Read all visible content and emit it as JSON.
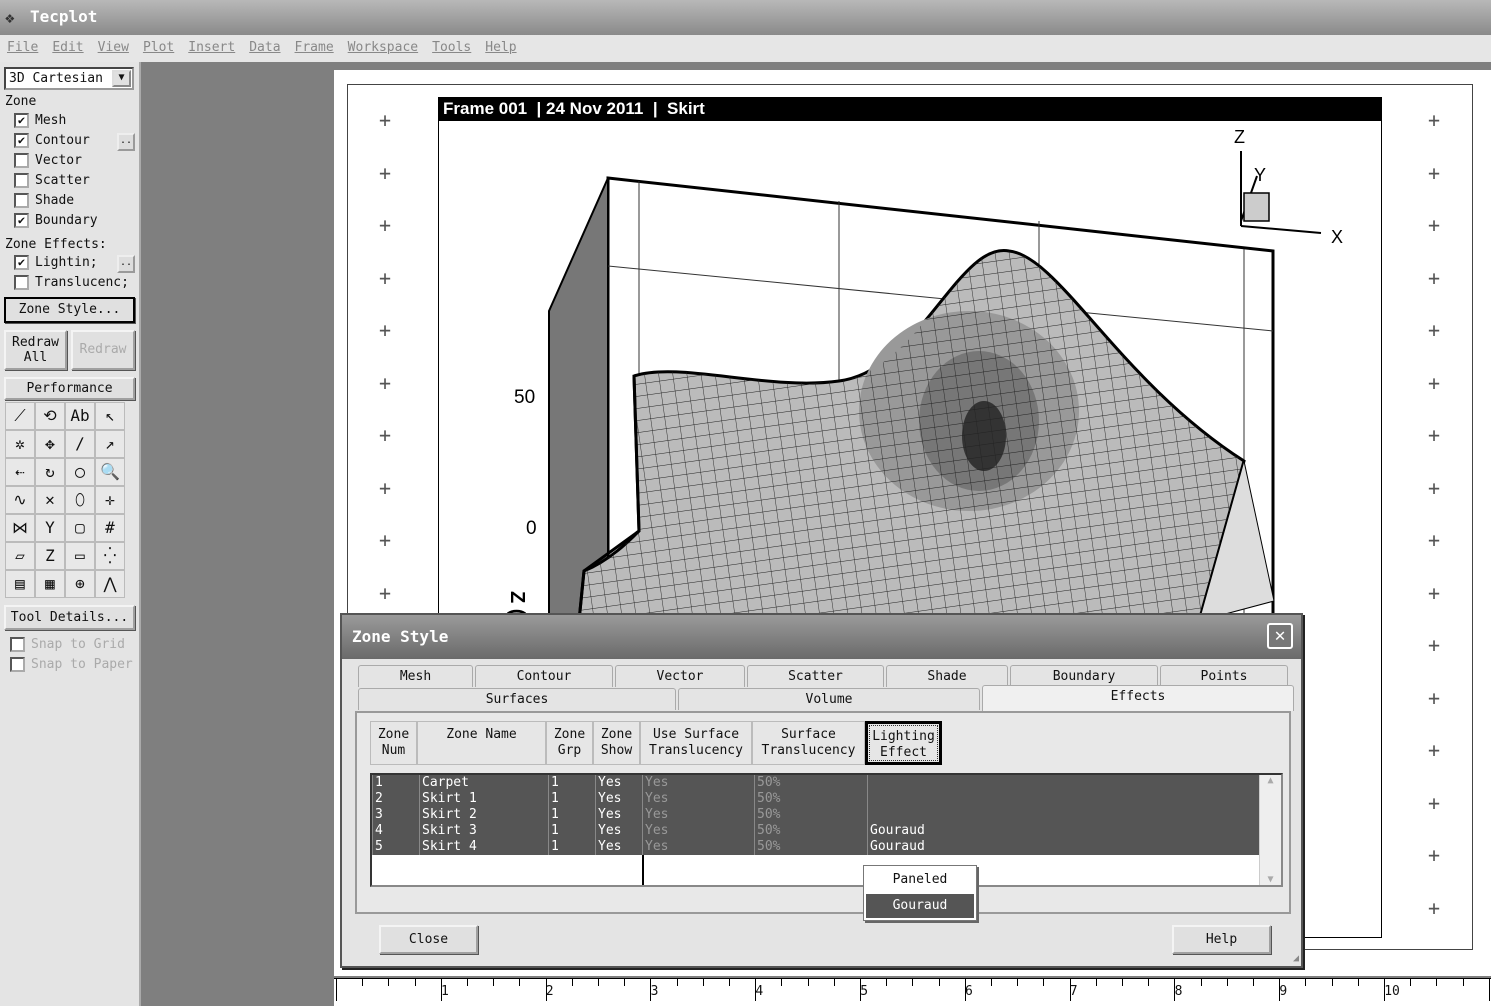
{
  "app": {
    "title": "Tecplot"
  },
  "menu": [
    "File",
    "Edit",
    "View",
    "Plot",
    "Insert",
    "Data",
    "Frame",
    "Workspace",
    "Tools",
    "Help"
  ],
  "sidebar": {
    "plot_type": "3D Cartesian",
    "zone_label": "Zone",
    "zone_layers": [
      {
        "label": "Mesh",
        "checked": true
      },
      {
        "label": "Contour",
        "checked": true
      },
      {
        "label": "Vector",
        "checked": false
      },
      {
        "label": "Scatter",
        "checked": false
      },
      {
        "label": "Shade",
        "checked": false
      },
      {
        "label": "Boundary",
        "checked": true
      }
    ],
    "effects_label": "Zone Effects:",
    "effects": [
      {
        "label": "Lightin;",
        "checked": true
      },
      {
        "label": "Translucenc;",
        "checked": false
      }
    ],
    "zone_style_button": "Zone Style...",
    "redraw_all": "Redraw All",
    "redraw": "Redraw",
    "performance": "Performance",
    "tool_details": "Tool Details...",
    "snap_grid": "Snap to Grid",
    "snap_paper": "Snap to Paper",
    "tool_icons": [
      "⟋",
      "⟲",
      "Ab",
      "↖",
      "✲",
      "✥",
      "∕",
      "↗",
      "⇠",
      "↻",
      "◯",
      "🔍",
      "∿",
      "✕",
      "⬯",
      "✛",
      "⋈",
      "Y",
      "▢",
      "#",
      "▱",
      "Z",
      "▭",
      "⁛",
      "▤",
      "▦",
      "⊕",
      "⋀"
    ]
  },
  "plot": {
    "header": "Frame 001  | 24 Nov 2011  |  Skirt",
    "axis_z_title": "Z (M)",
    "z_ticks": [
      "50",
      "0"
    ],
    "triad": {
      "x": "X",
      "y": "Y",
      "z": "Z"
    }
  },
  "ruler": {
    "labels": [
      "1",
      "2",
      "3",
      "4",
      "5",
      "6",
      "7",
      "8",
      "9",
      "10"
    ]
  },
  "dialog": {
    "title": "Zone Style",
    "tabs_row1": [
      "Mesh",
      "Contour",
      "Vector",
      "Scatter",
      "Shade",
      "Boundary",
      "Points"
    ],
    "tabs_row2": [
      "Surfaces",
      "Volume",
      "Effects"
    ],
    "active_tab": "Effects",
    "columns": [
      "Zone Num",
      "Zone Name",
      "Zone Grp",
      "Zone Show",
      "Use Surface Translucency",
      "Surface Translucency",
      "Lighting Effect"
    ],
    "rows": [
      [
        "1",
        "Carpet",
        "1",
        "Yes",
        "Yes",
        "50%",
        ""
      ],
      [
        "2",
        "Skirt 1",
        "1",
        "Yes",
        "Yes",
        "50%",
        ""
      ],
      [
        "3",
        "Skirt 2",
        "1",
        "Yes",
        "Yes",
        "50%",
        ""
      ],
      [
        "4",
        "Skirt 3",
        "1",
        "Yes",
        "Yes",
        "50%",
        "Gouraud"
      ],
      [
        "5",
        "Skirt 4",
        "1",
        "Yes",
        "Yes",
        "50%",
        "Gouraud"
      ]
    ],
    "dropdown_options": [
      "Paneled",
      "Gouraud"
    ],
    "dropdown_selected": "Gouraud",
    "close_button": "Close",
    "help_button": "Help"
  }
}
